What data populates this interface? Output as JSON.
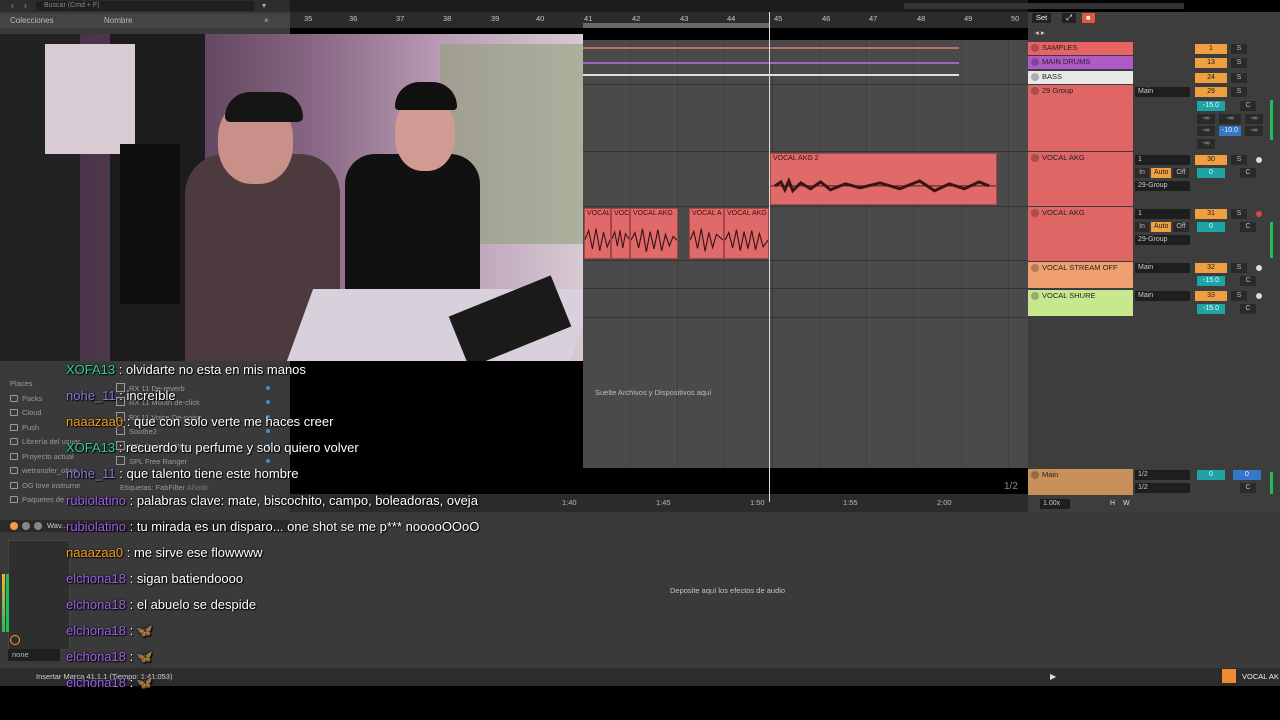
{
  "browser": {
    "search_placeholder": "Buscar (Cmd + F)",
    "collections_label": "Colecciones",
    "name_header": "Nombre",
    "places_label": "Places",
    "sidebar_items": [
      "Packs",
      "Cloud",
      "Push",
      "Librería del usuar",
      "Proyecto actual",
      "wetransfer_obse",
      "OG love instrume",
      "Paquetes de"
    ],
    "files": [
      "RX 11 De-reverb",
      "RX 11 Mouth de-click",
      "RX 11 Voice De-noise",
      "Soothe2",
      "SPL De-Verb Plus",
      "SPL Free Ranger"
    ],
    "tags_label": "Etiquetas:",
    "tags_value": "FabFilter",
    "tags_add": "Añadir",
    "device_title": "Wav...",
    "device_preset": "none"
  },
  "ruler": {
    "bars": [
      "35",
      "36",
      "37",
      "38",
      "39",
      "40",
      "41",
      "42",
      "43",
      "44",
      "45",
      "46",
      "47",
      "48",
      "49",
      "50"
    ],
    "times": [
      "1:40",
      "1:45",
      "1:50",
      "1:55",
      "2:00"
    ],
    "set_label": "Set"
  },
  "arrangement": {
    "drop_text": "Suelte Archivos y Dispositivos aquí",
    "page_indicator": "1/2",
    "clips": [
      {
        "label": "VOCAL AKG 2"
      },
      {
        "label": "VOCAL"
      },
      {
        "label": "VOC"
      },
      {
        "label": "VOCAL AKG"
      },
      {
        "label": "VOCAL A"
      },
      {
        "label": "VOCAL AKG"
      }
    ]
  },
  "tracks": [
    {
      "name": "SAMPLES",
      "color": "#e86464",
      "number": "1",
      "route": "",
      "vol": ""
    },
    {
      "name": "MAIN DRUMS",
      "color": "#b05ac8",
      "number": "13",
      "route": "",
      "vol": ""
    },
    {
      "name": "BASS",
      "color": "#e8e8e8",
      "number": "24",
      "route": "",
      "vol": ""
    },
    {
      "name": "29 Group",
      "color": "#e06666",
      "number": "29",
      "route": "Main",
      "vol": "-15.0"
    },
    {
      "name": "VOCAL AKG",
      "color": "#e06666",
      "number": "30",
      "route": "1",
      "vol": "0"
    },
    {
      "name": "VOCAL AKG",
      "color": "#e06666",
      "number": "31",
      "route": "1",
      "vol": "0"
    },
    {
      "name": "VOCAL STREAM OFF",
      "color": "#f0a070",
      "number": "32",
      "route": "Main",
      "vol": "-15.0"
    },
    {
      "name": "VOCAL SHURE",
      "color": "#c8e890",
      "number": "33",
      "route": "Main",
      "vol": "-15.0"
    },
    {
      "name": "Main",
      "color": "#c8905a",
      "number": "",
      "route": "1/2",
      "vol": "0"
    }
  ],
  "mixer": {
    "solo": "S",
    "center": "C",
    "inf": "-∞",
    "send_value": "-10.0",
    "in": "In",
    "auto": "Auto",
    "off": "Off",
    "group": "29-Group",
    "route_main": "1/2",
    "zoom": "1.00x",
    "h": "H",
    "w": "W"
  },
  "device_area": {
    "drop_text": "Deposite aquí los efectos de audio"
  },
  "status": {
    "text": "Insertar Marca 41.1.1 (Tiempo: 1:41:053)",
    "right": "VOCAL AK"
  },
  "chat": [
    {
      "user": "XOFA13",
      "color": "#2fd38a",
      "message": ": olvidarte no esta en mis manos"
    },
    {
      "user": "nohe_11",
      "color": "#8a7ad8",
      "message": ": increíble"
    },
    {
      "user": "naaazaa0",
      "color": "#f0a020",
      "message": ": que con solo verte me haces creer"
    },
    {
      "user": "XOFA13",
      "color": "#2fd38a",
      "message": ": recuerdo tu perfume y solo quiero volver"
    },
    {
      "user": "nohe_11",
      "color": "#8a7ad8",
      "message": ": que talento tiene este hombre"
    },
    {
      "user": "rubiolatino",
      "color": "#9e5ee8",
      "message": ": palabras clave: mate, biscochito, campo, boleadoras, oveja"
    },
    {
      "user": "rubiolatino",
      "color": "#9e5ee8",
      "message": ": tu mirada es un disparo... one shot se me p*** nooooOOoO"
    },
    {
      "user": "naaazaa0",
      "color": "#f0a020",
      "message": ": me sirve ese flowwww"
    },
    {
      "user": "elchona18",
      "color": "#9e5ee8",
      "message": ": sigan batiendoooo"
    },
    {
      "user": "elchona18",
      "color": "#9e5ee8",
      "message": ": el abuelo se despide"
    },
    {
      "user": "elchona18",
      "color": "#9e5ee8",
      "message": ": 🦋"
    },
    {
      "user": "elchona18",
      "color": "#9e5ee8",
      "message": ": 🦋"
    },
    {
      "user": "elchona18",
      "color": "#9e5ee8",
      "message": ": 🦋"
    }
  ]
}
